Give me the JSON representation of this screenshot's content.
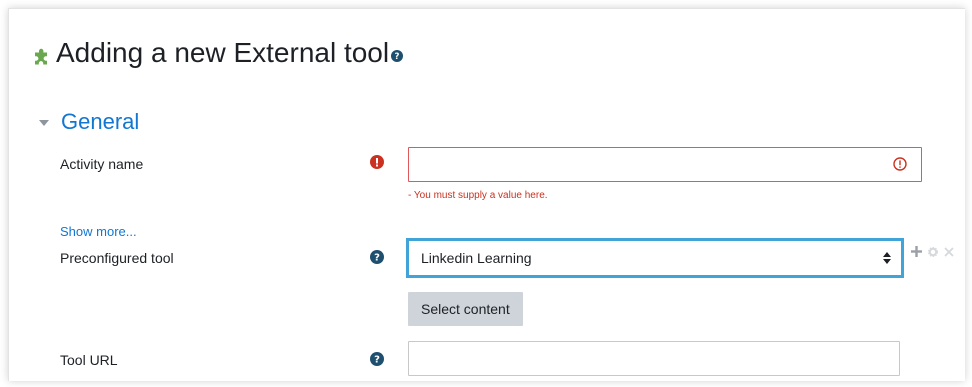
{
  "page": {
    "title": "Adding a new External tool"
  },
  "section": {
    "title": "General"
  },
  "fields": {
    "activity_name": {
      "label": "Activity name",
      "value": "",
      "error": "- You must supply a value here."
    },
    "show_more": "Show more...",
    "preconfigured_tool": {
      "label": "Preconfigured tool",
      "selected": "Linkedin Learning"
    },
    "select_content": "Select content",
    "tool_url": {
      "label": "Tool URL",
      "value": ""
    }
  },
  "colors": {
    "accent": "#1177d1",
    "error": "#ca3120",
    "focus": "#41a4d8",
    "help": "#1f4f6e",
    "puzzle": "#6aa84f"
  },
  "icons": {
    "heading": "puzzle-icon",
    "heading_help": "question-circle-icon",
    "required": "exclamation-circle-icon",
    "help": "question-circle-icon",
    "input_error": "exclamation-circle-outline-icon",
    "select_arrows": "sort-arrows-icon",
    "add": "plus-icon",
    "edit": "gear-icon",
    "delete": "times-icon"
  }
}
